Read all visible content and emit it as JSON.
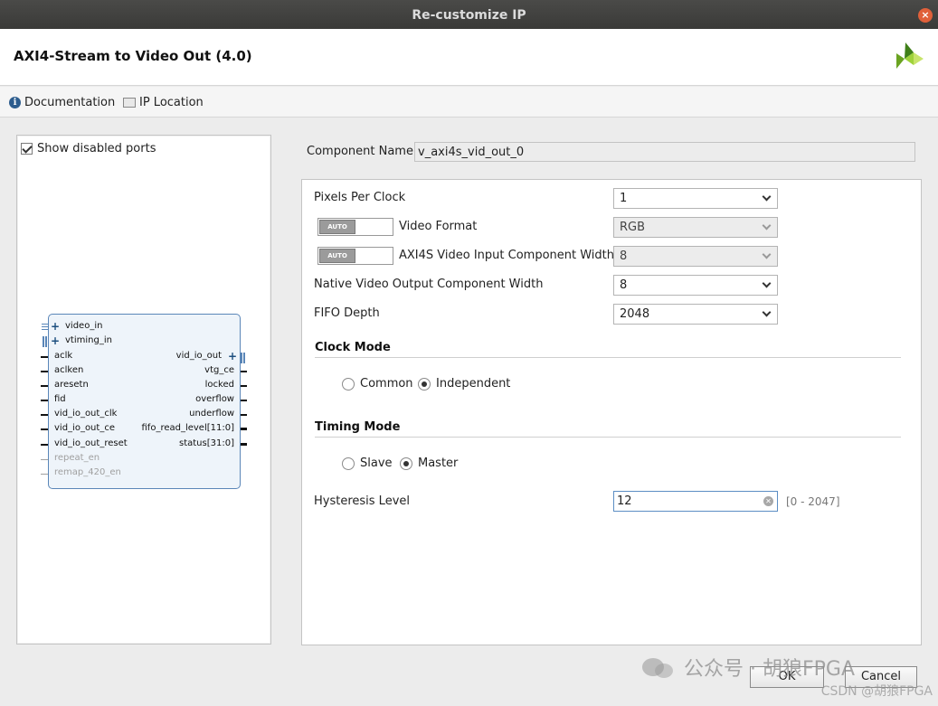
{
  "window": {
    "title": "Re-customize IP",
    "close_glyph": "×"
  },
  "header": {
    "ip_title": "AXI4-Stream to Video Out (4.0)",
    "logo": "xilinx-logo"
  },
  "toolbar": {
    "documentation": "Documentation",
    "ip_location": "IP Location"
  },
  "left_panel": {
    "show_disabled_ports": "Show disabled ports",
    "show_disabled_checked": true,
    "block": {
      "left_ports": [
        {
          "name": "video_in",
          "bus": true,
          "enabled": true
        },
        {
          "name": "vtiming_in",
          "bus": true,
          "enabled": true
        },
        {
          "name": "aclk",
          "enabled": true
        },
        {
          "name": "aclken",
          "enabled": true
        },
        {
          "name": "aresetn",
          "enabled": true
        },
        {
          "name": "fid",
          "enabled": true
        },
        {
          "name": "vid_io_out_clk",
          "enabled": true
        },
        {
          "name": "vid_io_out_ce",
          "enabled": true
        },
        {
          "name": "vid_io_out_reset",
          "enabled": true
        },
        {
          "name": "repeat_en",
          "enabled": false
        },
        {
          "name": "remap_420_en",
          "enabled": false
        }
      ],
      "right_ports": [
        {
          "name": "vid_io_out",
          "bus": true
        },
        {
          "name": "vtg_ce"
        },
        {
          "name": "locked"
        },
        {
          "name": "overflow"
        },
        {
          "name": "underflow"
        },
        {
          "name": "fifo_read_level[11:0]"
        },
        {
          "name": "status[31:0]"
        }
      ]
    }
  },
  "component_name": {
    "label": "Component Name",
    "value": "v_axi4s_vid_out_0"
  },
  "params": {
    "pixels_per_clock": {
      "label": "Pixels Per Clock",
      "value": "1"
    },
    "video_format": {
      "label": "Video Format",
      "value": "RGB",
      "auto": "AUTO"
    },
    "axi4s_width": {
      "label": "AXI4S Video Input Component Width",
      "value": "8",
      "auto": "AUTO"
    },
    "native_width": {
      "label": "Native Video Output Component Width",
      "value": "8"
    },
    "fifo_depth": {
      "label": "FIFO Depth",
      "value": "2048"
    }
  },
  "clock_mode": {
    "title": "Clock Mode",
    "options": [
      "Common",
      "Independent"
    ],
    "selected": "Independent"
  },
  "timing_mode": {
    "title": "Timing Mode",
    "options": [
      "Slave",
      "Master"
    ],
    "selected": "Master"
  },
  "hysteresis": {
    "label": "Hysteresis Level",
    "value": "12",
    "range": "[0 - 2047]"
  },
  "buttons": {
    "ok": "OK",
    "cancel": "Cancel"
  },
  "watermark": {
    "line1": "公众号 · 胡狼FPGA",
    "line2": "CSDN @胡狼FPGA"
  }
}
